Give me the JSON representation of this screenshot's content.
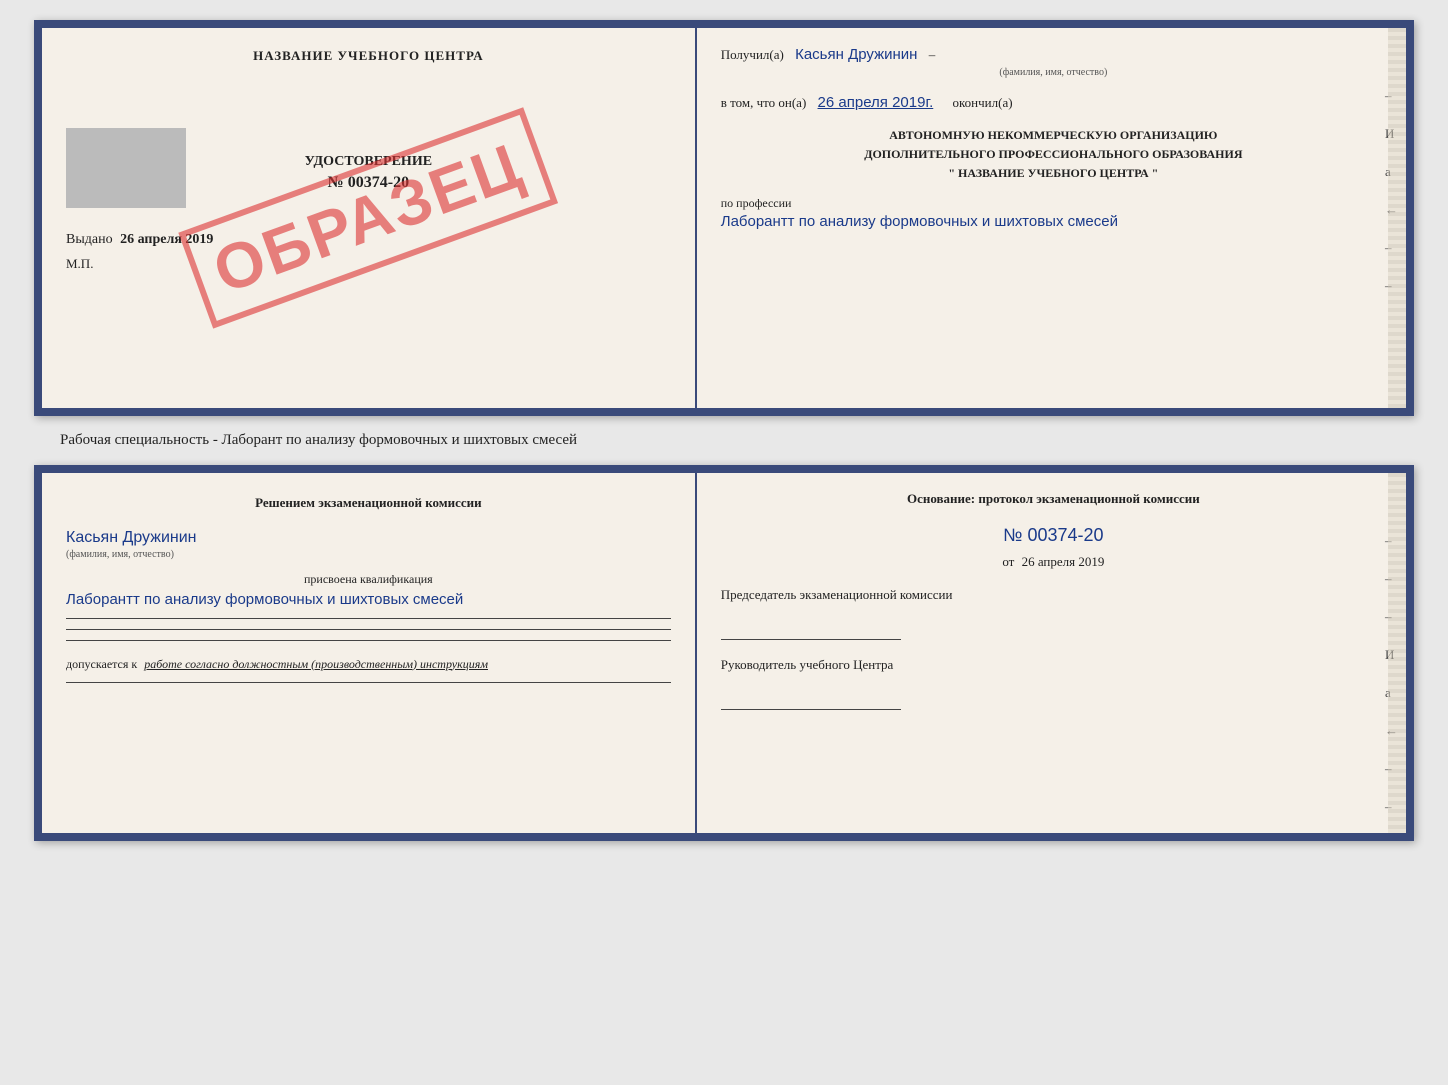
{
  "top_doc": {
    "left": {
      "title": "НАЗВАНИЕ УЧЕБНОГО ЦЕНТРА",
      "cert_label": "УДОСТОВЕРЕНИЕ",
      "cert_number": "№ 00374-20",
      "issued_label": "Выдано",
      "issued_date": "26 апреля 2019",
      "mp_label": "М.П.",
      "stamp_text": "ОБРАЗЕЦ"
    },
    "right": {
      "received_label": "Получил(а)",
      "received_name": "Касьян Дружинин",
      "fio_label": "(фамилия, имя, отчество)",
      "in_that_label": "в том, что он(а)",
      "completion_date": "26 апреля 2019г.",
      "finished_label": "окончил(а)",
      "org_line1": "АВТОНОМНУЮ НЕКОММЕРЧЕСКУЮ ОРГАНИЗАЦИЮ",
      "org_line2": "ДОПОЛНИТЕЛЬНОГО ПРОФЕССИОНАЛЬНОГО ОБРАЗОВАНИЯ",
      "org_line3": "\"  НАЗВАНИЕ УЧЕБНОГО ЦЕНТРА  \"",
      "profession_label": "по профессии",
      "profession_text": "Лаборантт по анализу формовочных и шихтовых смесей"
    }
  },
  "separator": {
    "text": "Рабочая специальность - Лаборант по анализу формовочных и шихтовых смесей"
  },
  "bottom_doc": {
    "left": {
      "heading": "Решением  экзаменационной  комиссии",
      "name_hw": "Касьян Дружинин",
      "fio_label": "(фамилия, имя, отчество)",
      "qual_label": "присвоена квалификация",
      "qual_text": "Лаборантт по анализу формовочных и шихтовых смесей",
      "admit_label": "допускается к",
      "admit_italic": "работе согласно должностным (производственным) инструкциям"
    },
    "right": {
      "basis_heading": "Основание: протокол экзаменационной  комиссии",
      "protocol_number": "№  00374-20",
      "date_prefix": "от",
      "protocol_date": "26 апреля 2019",
      "chairman_label": "Председатель экзаменационной комиссии",
      "director_label": "Руководитель учебного Центра"
    }
  },
  "side_marks": {
    "i_mark": "И",
    "a_mark": "а",
    "arrow": "←"
  }
}
